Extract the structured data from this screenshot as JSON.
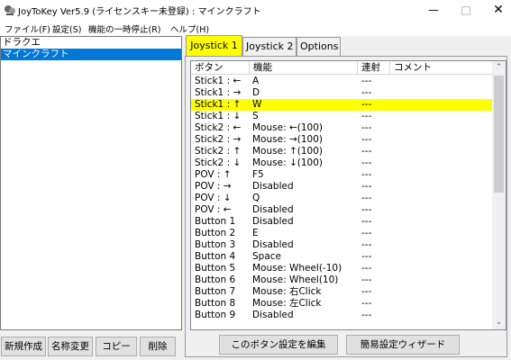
{
  "window": {
    "title": "JoyToKey Ver5.9 (ライセンスキー未登録) : マインクラフト",
    "minimize": "—",
    "maximize": "□",
    "close": "✕"
  },
  "menu": [
    "ファイル(F)",
    "設定(S)",
    "機能の一時停止(R)",
    "ヘルプ(H)"
  ],
  "profiles": [
    {
      "label": "ドラクエ",
      "selected": false
    },
    {
      "label": "マインクラフト",
      "selected": true
    }
  ],
  "profile_buttons": {
    "new": "新規作成",
    "rename": "名称変更",
    "copy": "コピー",
    "delete": "削除"
  },
  "tabs": [
    "Joystick 1",
    "Joystick 2",
    "Options"
  ],
  "active_tab": 0,
  "grid": {
    "columns": [
      "ボタン",
      "機能",
      "連射",
      "コメント"
    ],
    "rows": [
      {
        "button": "Stick1 : ←",
        "function": "A",
        "repeat": "---"
      },
      {
        "button": "Stick1 : →",
        "function": "D",
        "repeat": "---"
      },
      {
        "button": "Stick1 : ↑",
        "function": "W",
        "repeat": "---",
        "highlight": true
      },
      {
        "button": "Stick1 : ↓",
        "function": "S",
        "repeat": "---"
      },
      {
        "button": "Stick2 : ←",
        "function": "Mouse: ←(100)",
        "repeat": "---"
      },
      {
        "button": "Stick2 : →",
        "function": "Mouse: →(100)",
        "repeat": "---"
      },
      {
        "button": "Stick2 : ↑",
        "function": "Mouse: ↑(100)",
        "repeat": "---"
      },
      {
        "button": "Stick2 : ↓",
        "function": "Mouse: ↓(100)",
        "repeat": "---"
      },
      {
        "button": "POV : ↑",
        "function": "F5",
        "repeat": "---"
      },
      {
        "button": "POV : →",
        "function": "Disabled",
        "repeat": "---"
      },
      {
        "button": "POV : ↓",
        "function": "Q",
        "repeat": "---"
      },
      {
        "button": "POV : ←",
        "function": "Disabled",
        "repeat": "---"
      },
      {
        "button": "Button 1",
        "function": "Disabled",
        "repeat": "---"
      },
      {
        "button": "Button 2",
        "function": "E",
        "repeat": "---"
      },
      {
        "button": "Button 3",
        "function": "Disabled",
        "repeat": "---"
      },
      {
        "button": "Button 4",
        "function": "Space",
        "repeat": "---"
      },
      {
        "button": "Button 5",
        "function": "Mouse: Wheel(-10)",
        "repeat": "---"
      },
      {
        "button": "Button 6",
        "function": "Mouse: Wheel(10)",
        "repeat": "---"
      },
      {
        "button": "Button 7",
        "function": "Mouse: 右Click",
        "repeat": "---"
      },
      {
        "button": "Button 8",
        "function": "Mouse: 左Click",
        "repeat": "---"
      },
      {
        "button": "Button 9",
        "function": "Disabled",
        "repeat": "---"
      }
    ]
  },
  "bottom_buttons": {
    "edit": "このボタン設定を編集",
    "wizard": "簡易設定ウィザード"
  },
  "colors": {
    "highlight": "#ffff00",
    "selection": "#0078d7"
  }
}
